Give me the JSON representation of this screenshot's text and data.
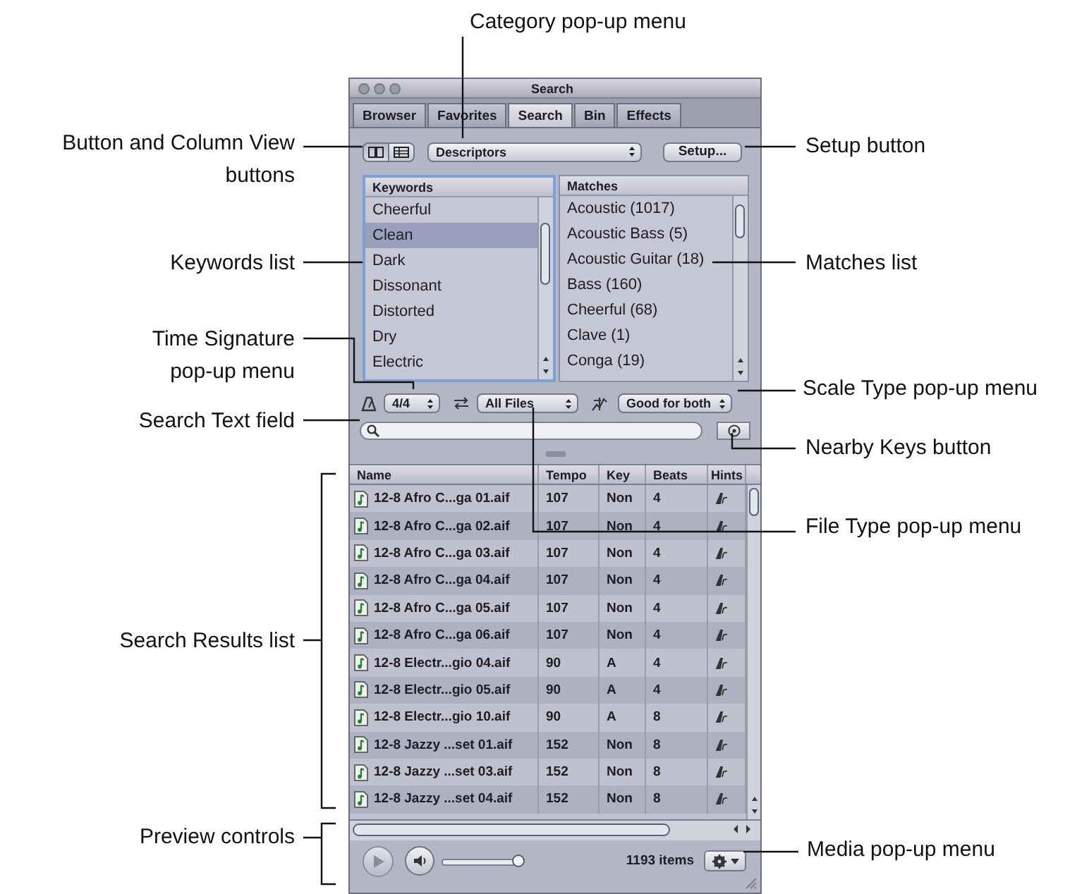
{
  "callouts": [
    "Category pop-up menu",
    "Button and Column View buttons",
    "Setup button",
    "Keywords list",
    "Matches list",
    "Time Signature pop-up menu",
    "Scale Type pop-up menu",
    "Search Text field",
    "Nearby Keys button",
    "File Type pop-up menu",
    "Search Results list",
    "Preview controls",
    "Media pop-up menu"
  ],
  "window": {
    "title": "Search"
  },
  "tabs": [
    {
      "label": "Browser",
      "selected": false
    },
    {
      "label": "Favorites",
      "selected": false
    },
    {
      "label": "Search",
      "selected": true
    },
    {
      "label": "Bin",
      "selected": false
    },
    {
      "label": "Effects",
      "selected": false
    }
  ],
  "view_buttons": [
    {
      "kind": "columns",
      "selected": true
    },
    {
      "kind": "list",
      "selected": false
    }
  ],
  "category_popup": {
    "value": "Descriptors"
  },
  "setup_button": {
    "label": "Setup..."
  },
  "keywords": {
    "header": "Keywords",
    "items": [
      {
        "label": "Cheerful",
        "selected": false
      },
      {
        "label": "Clean",
        "selected": true
      },
      {
        "label": "Dark",
        "selected": false
      },
      {
        "label": "Dissonant",
        "selected": false
      },
      {
        "label": "Distorted",
        "selected": false
      },
      {
        "label": "Dry",
        "selected": false
      },
      {
        "label": "Electric",
        "selected": false
      }
    ]
  },
  "matches": {
    "header": "Matches",
    "items": [
      "Acoustic (1017)",
      "Acoustic Bass (5)",
      "Acoustic Guitar (18)",
      "Bass (160)",
      "Cheerful (68)",
      "Clave (1)",
      "Conga (19)"
    ]
  },
  "filters": {
    "time_signature": "4/4",
    "file_type": "All Files",
    "scale_type": "Good for both"
  },
  "results": {
    "columns": [
      "Name",
      "Tempo",
      "Key",
      "Beats",
      "Hints"
    ],
    "rows": [
      {
        "name": "12-8 Afro C...ga 01.aif",
        "tempo": "107",
        "key": "Non",
        "beats": "4"
      },
      {
        "name": "12-8 Afro C...ga 02.aif",
        "tempo": "107",
        "key": "Non",
        "beats": "4"
      },
      {
        "name": "12-8 Afro C...ga 03.aif",
        "tempo": "107",
        "key": "Non",
        "beats": "4"
      },
      {
        "name": "12-8 Afro C...ga 04.aif",
        "tempo": "107",
        "key": "Non",
        "beats": "4"
      },
      {
        "name": "12-8 Afro C...ga 05.aif",
        "tempo": "107",
        "key": "Non",
        "beats": "4"
      },
      {
        "name": "12-8 Afro C...ga 06.aif",
        "tempo": "107",
        "key": "Non",
        "beats": "4"
      },
      {
        "name": "12-8 Electr...gio 04.aif",
        "tempo": "90",
        "key": "A",
        "beats": "4"
      },
      {
        "name": "12-8 Electr...gio 05.aif",
        "tempo": "90",
        "key": "A",
        "beats": "4"
      },
      {
        "name": "12-8 Electr...gio 10.aif",
        "tempo": "90",
        "key": "A",
        "beats": "8"
      },
      {
        "name": "12-8 Jazzy ...set 01.aif",
        "tempo": "152",
        "key": "Non",
        "beats": "8"
      },
      {
        "name": "12-8 Jazzy ...set 03.aif",
        "tempo": "152",
        "key": "Non",
        "beats": "8"
      },
      {
        "name": "12-8 Jazzy ...set 04.aif",
        "tempo": "152",
        "key": "Non",
        "beats": "8"
      }
    ]
  },
  "preview": {
    "volume": {
      "level": 0.95
    }
  },
  "status": {
    "item_count": "1193 items"
  }
}
